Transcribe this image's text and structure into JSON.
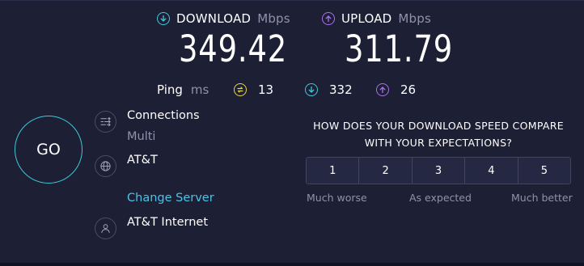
{
  "download": {
    "title": "DOWNLOAD",
    "unit": "Mbps",
    "value": "349.42",
    "icon": "download-arrow-icon",
    "color": "#3ec9d8"
  },
  "upload": {
    "title": "UPLOAD",
    "unit": "Mbps",
    "value": "311.79",
    "icon": "upload-arrow-icon",
    "color": "#a971e9"
  },
  "ping": {
    "label": "Ping",
    "unit": "ms",
    "idle": {
      "value": "13",
      "icon": "idle-latency-icon",
      "color": "#e8d545"
    },
    "download": {
      "value": "332",
      "icon": "download-latency-icon",
      "color": "#3ec9d8"
    },
    "upload": {
      "value": "26",
      "icon": "upload-latency-icon",
      "color": "#a971e9"
    }
  },
  "go_button": {
    "label": "GO"
  },
  "connections": {
    "label": "Connections",
    "value": "Multi",
    "icon": "connections-icon"
  },
  "server": {
    "name": "AT&T",
    "change_label": "Change Server",
    "icon": "globe-icon"
  },
  "provider": {
    "name": "AT&T Internet",
    "icon": "user-icon"
  },
  "survey": {
    "question_line1": "HOW DOES YOUR DOWNLOAD SPEED COMPARE",
    "question_line2": "WITH YOUR EXPECTATIONS?",
    "options": [
      "1",
      "2",
      "3",
      "4",
      "5"
    ],
    "label_low": "Much worse",
    "label_mid": "As expected",
    "label_high": "Much better"
  },
  "colors": {
    "background": "#1d1f35",
    "accent": "#3ec9d8",
    "link": "#4cc3e5",
    "muted": "#8f92ad"
  }
}
